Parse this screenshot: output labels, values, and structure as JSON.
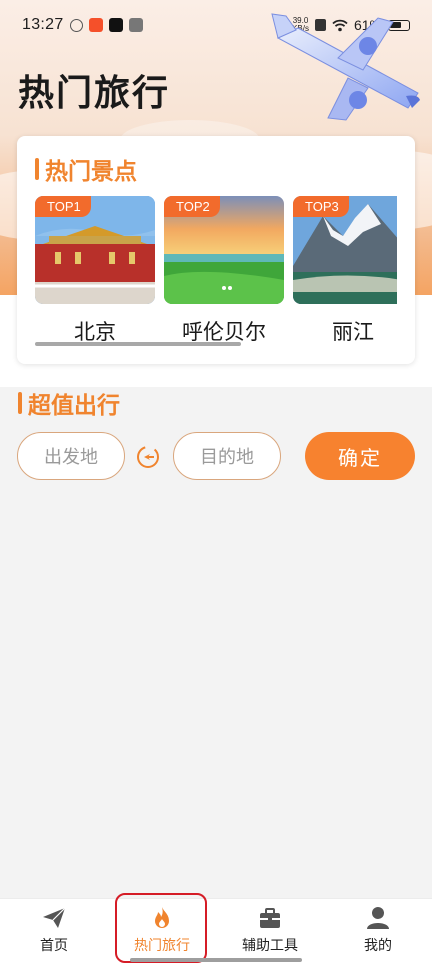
{
  "status_bar": {
    "time": "13:27",
    "net_speed_value": "39.0",
    "net_speed_unit": "KB/s",
    "battery": "61%"
  },
  "page_title": "热门旅行",
  "hot_spots": {
    "title": "热门景点",
    "items": [
      {
        "rank": "TOP1",
        "name": "北京"
      },
      {
        "rank": "TOP2",
        "name": "呼伦贝尔"
      },
      {
        "rank": "TOP3",
        "name": "丽江"
      }
    ]
  },
  "deals": {
    "title": "超值出行",
    "from_placeholder": "出发地",
    "to_placeholder": "目的地",
    "confirm_label": "确定"
  },
  "bottom_nav": {
    "items": [
      {
        "label": "首页",
        "icon": "paper-plane-icon"
      },
      {
        "label": "热门旅行",
        "icon": "flame-icon",
        "active": true
      },
      {
        "label": "辅助工具",
        "icon": "toolbox-icon"
      },
      {
        "label": "我的",
        "icon": "user-icon"
      }
    ]
  },
  "colors": {
    "accent": "#f0842e",
    "button": "#f7822f",
    "badge": "#f26b2c",
    "highlight_box": "#d51c26"
  }
}
